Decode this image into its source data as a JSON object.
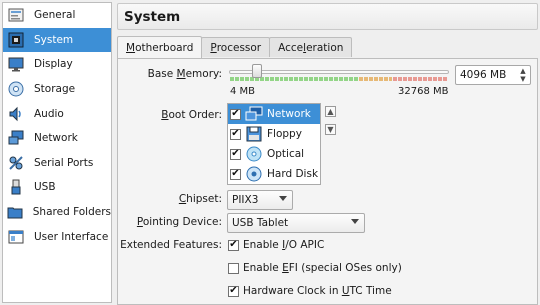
{
  "sidebar": {
    "items": [
      {
        "label": "General",
        "icon": "general-icon"
      },
      {
        "label": "System",
        "icon": "system-icon",
        "selected": true
      },
      {
        "label": "Display",
        "icon": "display-icon"
      },
      {
        "label": "Storage",
        "icon": "storage-icon"
      },
      {
        "label": "Audio",
        "icon": "audio-icon"
      },
      {
        "label": "Network",
        "icon": "network-icon"
      },
      {
        "label": "Serial Ports",
        "icon": "serial-ports-icon"
      },
      {
        "label": "USB",
        "icon": "usb-icon"
      },
      {
        "label": "Shared Folders",
        "icon": "shared-folders-icon"
      },
      {
        "label": "User Interface",
        "icon": "user-interface-icon"
      }
    ]
  },
  "header": {
    "title": "System"
  },
  "tabs": [
    {
      "pre": "",
      "ul": "M",
      "post": "otherboard",
      "active": true
    },
    {
      "pre": "",
      "ul": "P",
      "post": "rocessor",
      "active": false
    },
    {
      "pre": "Acce",
      "ul": "l",
      "post": "eration",
      "active": false
    }
  ],
  "memory": {
    "label_pre": "Base ",
    "label_ul": "M",
    "label_post": "emory:",
    "value": "4096 MB",
    "min_label": "4 MB",
    "max_label": "32768 MB",
    "fraction": 0.125,
    "colors": {
      "green": "#93d587",
      "orange": "#e7b976",
      "red": "#e89a93"
    }
  },
  "boot_order": {
    "label_pre": "",
    "label_ul": "B",
    "label_post": "oot Order:",
    "items": [
      {
        "label": "Network",
        "checked": true,
        "icon": "network-boot-icon",
        "selected": true
      },
      {
        "label": "Floppy",
        "checked": true,
        "icon": "floppy-icon",
        "selected": false
      },
      {
        "label": "Optical",
        "checked": true,
        "icon": "optical-disc-icon",
        "selected": false
      },
      {
        "label": "Hard Disk",
        "checked": true,
        "icon": "hard-disk-icon",
        "selected": false
      }
    ],
    "up_icon": "move-up-icon",
    "down_icon": "move-down-icon"
  },
  "chipset": {
    "label_pre": "",
    "label_ul": "C",
    "label_post": "hipset:",
    "value": "PIIX3"
  },
  "pointing": {
    "label_pre": "",
    "label_ul": "P",
    "label_post": "ointing Device:",
    "value": "USB Tablet"
  },
  "extended": {
    "label": "Extended Features:",
    "options": [
      {
        "pre": "Enable ",
        "ul": "I",
        "post": "/O APIC",
        "checked": true
      },
      {
        "pre": "Enable ",
        "ul": "E",
        "post": "FI (special OSes only)",
        "checked": false
      },
      {
        "pre": "Hardware Clock in ",
        "ul": "U",
        "post": "TC Time",
        "checked": true
      }
    ]
  },
  "colors": {
    "accent": "#3d8fd6"
  }
}
